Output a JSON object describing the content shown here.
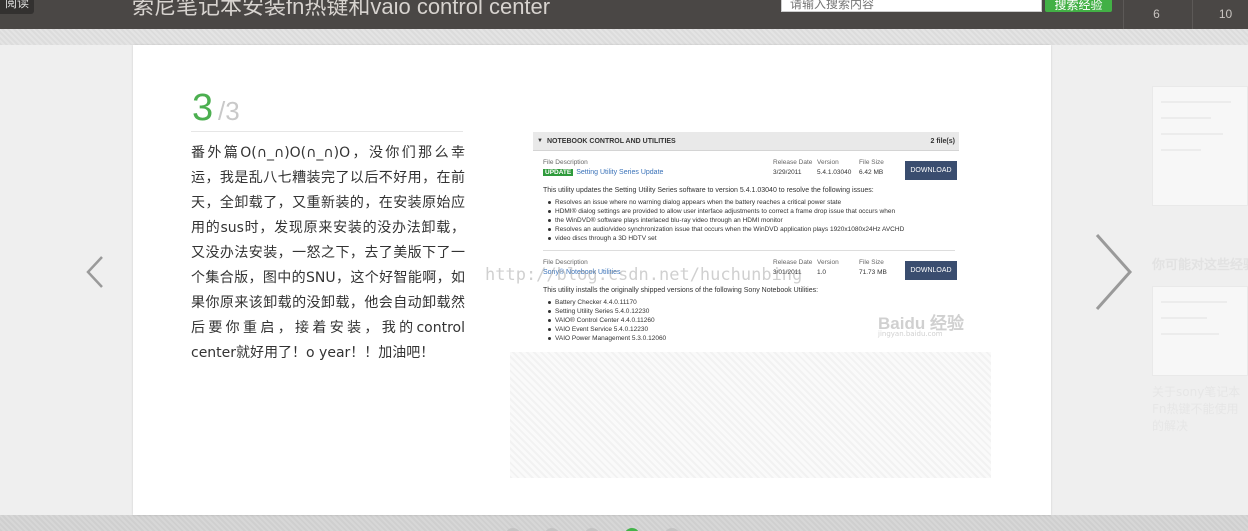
{
  "header": {
    "back_label": "阅读",
    "title": "索尼笔记本安装fn热键和vaio control center",
    "search_placeholder": "请输入搜索内容",
    "search_button": "搜索经验",
    "stats": [
      "6",
      "10"
    ]
  },
  "step": {
    "number": "3",
    "total": "/3",
    "text": "番外篇O(∩_∩)O(∩_∩)O，没你们那么幸运，我是乱八七糟装完了以后不好用，在前天，全卸载了，又重新装的，在安装原始应用的sus时，发现原来安装的没办法卸载，又没办法安装，一怒之下，去了美版下了一个集合版，图中的SNU，这个好智能啊，如果你原来该卸载的没卸载，他会自动卸载然后要你重启，接着安装，我的control center就好用了！o year！！加油吧！"
  },
  "screenshot": {
    "header": "NOTEBOOK CONTROL AND UTILITIES",
    "count": "2 file(s)",
    "col_labels": {
      "file_description": "File Description",
      "release_date": "Release Date",
      "version": "Version",
      "file_size": "File Size"
    },
    "download_label": "DOWNLOAD",
    "items": [
      {
        "badge": "UPDATE",
        "name": "Setting Utility Series Update",
        "date": "3/29/2011",
        "version": "5.4.1.03040",
        "size": "6.42 MB",
        "description": "This utility updates the Setting Utility Series software to version 5.4.1.03040 to resolve the following issues:",
        "bullets": [
          "Resolves an issue where no warning dialog appears when the battery reaches a critical power state",
          "HDMI® dialog settings are provided to allow user interface adjustments to correct a frame drop issue that occurs when",
          "the WinDVD® software plays interlaced blu-ray video through an HDMI monitor",
          "Resolves an audio/video synchronization issue that occurs when the WinDVD application plays 1920x1080x24Hz AVCHD",
          "video discs through a 3D HDTV set"
        ]
      },
      {
        "badge": "",
        "name": "Sony® Notebook Utilities",
        "date": "3/01/2011",
        "version": "1.0",
        "size": "71.73 MB",
        "description": "This utility installs the originally shipped versions of the following Sony Notebook Utilities:",
        "bullets": [
          "Battery Checker 4.4.0.11170",
          "Setting Utility Series 5.4.0.12230",
          "VAIO® Control Center 4.4.0.11260",
          "VAIO Event Service 5.4.0.12230",
          "VAIO Power Management 5.3.0.12060"
        ]
      }
    ],
    "watermark_url": "http://blog.csdn.net/huchunbing",
    "watermark_brand": "Baidu 经验",
    "watermark_sub": "jingyan.baidu.com"
  },
  "sidebar": {
    "heading": "你可能对这些经验感兴趣",
    "desc": "关于sony笔记本Fn热键不能使用的解决"
  },
  "icons": {
    "prev": "chevron-left-icon",
    "next": "chevron-right-icon"
  },
  "colors": {
    "accent_green": "#4caf50",
    "header_bg": "#4a4745",
    "download_blue": "#3a4d6f"
  },
  "pagination": {
    "pages": 5,
    "active_index": 3
  }
}
